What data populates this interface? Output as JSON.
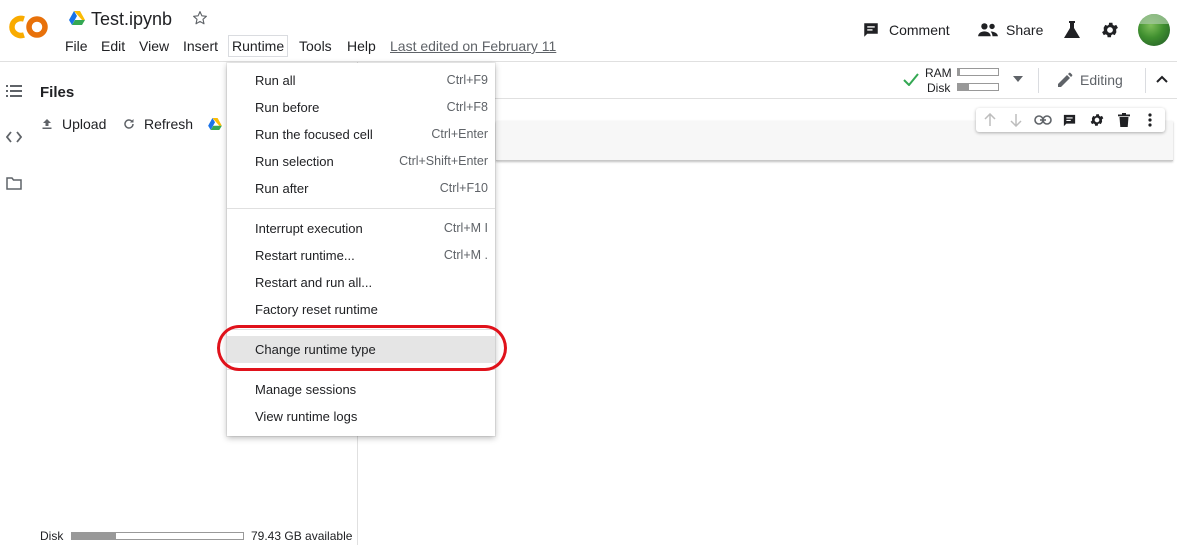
{
  "app": {
    "logo_text": "CO",
    "notebook_title": "Test.ipynb",
    "last_edited": "Last edited on February 11"
  },
  "menubar": [
    "File",
    "Edit",
    "View",
    "Insert",
    "Runtime",
    "Tools",
    "Help"
  ],
  "header_actions": {
    "comment_label": "Comment",
    "share_label": "Share"
  },
  "toolbar": {
    "ram_label": "RAM",
    "disk_label": "Disk",
    "ram_usage": 0.04,
    "disk_usage": 0.28,
    "editing_label": "Editing"
  },
  "files_panel": {
    "title": "Files",
    "upload_label": "Upload",
    "refresh_label": "Refresh",
    "disk_label": "Disk",
    "disk_available": "79.43 GB available",
    "disk_usage": 0.26
  },
  "runtime_menu": {
    "groups": [
      [
        {
          "label": "Run all",
          "shortcut": "Ctrl+F9"
        },
        {
          "label": "Run before",
          "shortcut": "Ctrl+F8"
        },
        {
          "label": "Run the focused cell",
          "shortcut": "Ctrl+Enter"
        },
        {
          "label": "Run selection",
          "shortcut": "Ctrl+Shift+Enter"
        },
        {
          "label": "Run after",
          "shortcut": "Ctrl+F10"
        }
      ],
      [
        {
          "label": "Interrupt execution",
          "shortcut": "Ctrl+M I"
        },
        {
          "label": "Restart runtime...",
          "shortcut": "Ctrl+M ."
        },
        {
          "label": "Restart and run all...",
          "shortcut": ""
        },
        {
          "label": "Factory reset runtime",
          "shortcut": ""
        }
      ],
      [
        {
          "label": "Change runtime type",
          "shortcut": "",
          "highlighted": true
        }
      ],
      [
        {
          "label": "Manage sessions",
          "shortcut": ""
        },
        {
          "label": "View runtime logs",
          "shortcut": ""
        }
      ]
    ]
  },
  "colors": {
    "logo_orange": "#F9AB00",
    "logo_dark_orange": "#E8710A",
    "connected_green": "#34A853",
    "annotation_red": "#E0121B"
  }
}
